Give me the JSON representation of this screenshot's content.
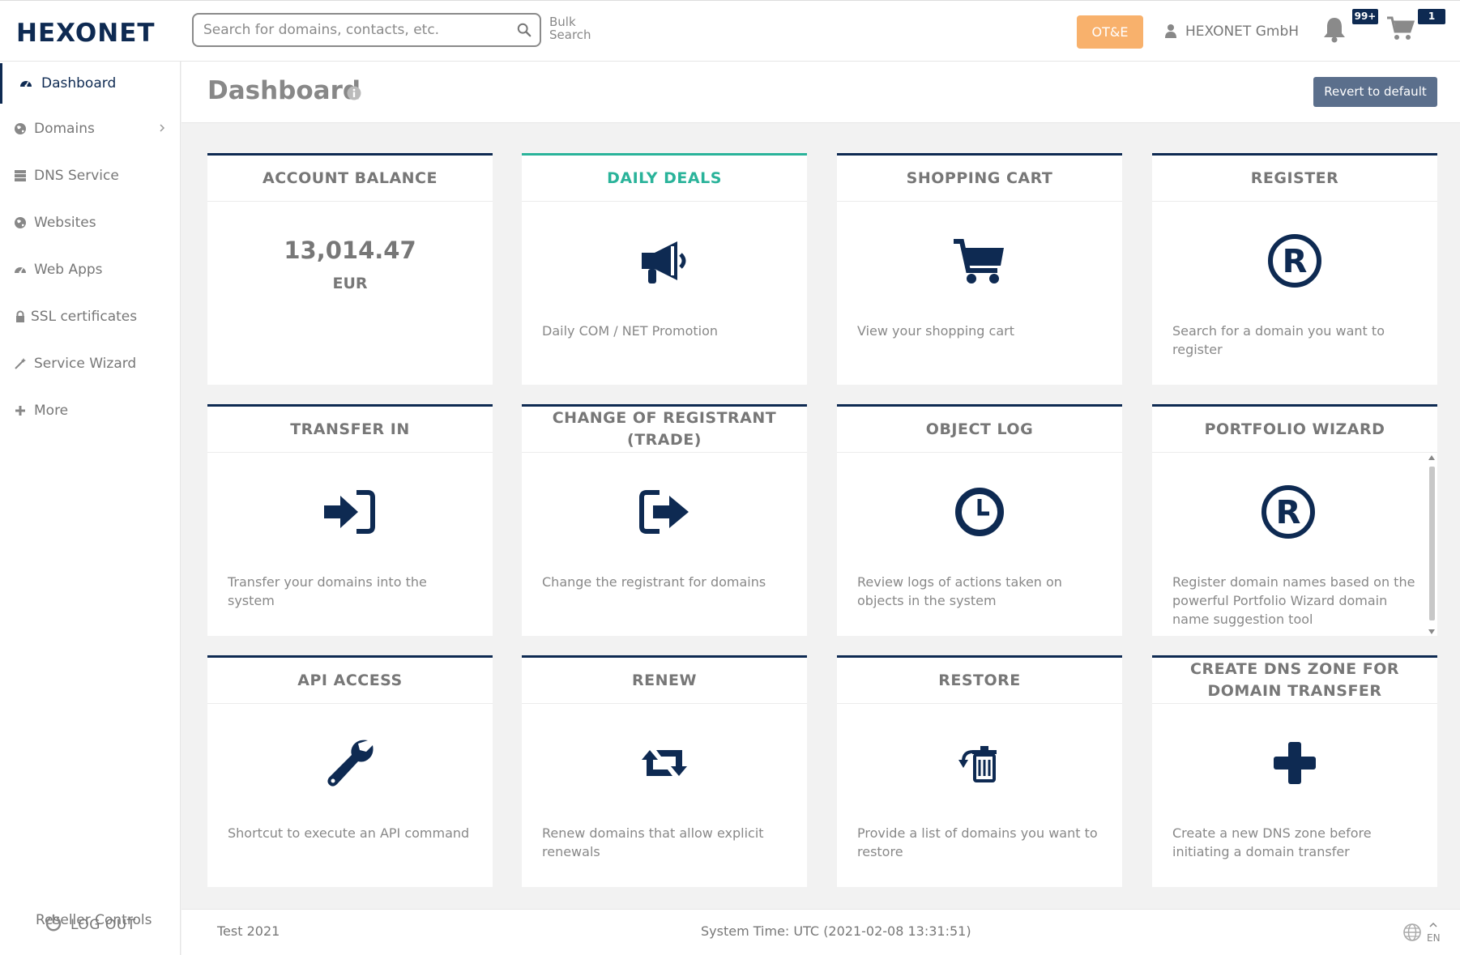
{
  "header": {
    "logo": "HEXONET",
    "search_placeholder": "Search for domains, contacts, etc.",
    "bulk_search_line1": "Bulk",
    "bulk_search_line2": "Search",
    "environment_button": "OT&E",
    "user_name": "HEXONET GmbH",
    "notifications_badge": "99+",
    "cart_badge": "1"
  },
  "sidebar": {
    "items": [
      {
        "label": "Dashboard",
        "icon": "dashboard-icon",
        "active": true
      },
      {
        "label": "Domains",
        "icon": "globe-icon",
        "has_submenu": true
      },
      {
        "label": "DNS Service",
        "icon": "server-icon"
      },
      {
        "label": "Websites",
        "icon": "globe-icon"
      },
      {
        "label": "Web Apps",
        "icon": "dashboard-icon"
      },
      {
        "label": "SSL certificates",
        "icon": "lock-icon"
      },
      {
        "label": "Service Wizard",
        "icon": "magic-wand-icon"
      },
      {
        "label": "More",
        "icon": "plus-icon"
      }
    ],
    "reseller_controls": "Reseller Controls",
    "logout": "LOG OUT"
  },
  "page": {
    "title": "Dashboard",
    "revert_button": "Revert to default"
  },
  "tiles": [
    {
      "title": "ACCOUNT BALANCE",
      "value": "13,014.47",
      "currency": "EUR"
    },
    {
      "title": "DAILY DEALS",
      "icon": "megaphone-icon",
      "description": "Daily COM / NET Promotion"
    },
    {
      "title": "SHOPPING CART",
      "icon": "cart-icon",
      "description": "View your shopping cart"
    },
    {
      "title": "REGISTER",
      "icon": "registered-icon",
      "description": "Search for a domain you want to register"
    },
    {
      "title": "TRANSFER IN",
      "icon": "sign-in-icon",
      "description": "Transfer your domains into the system"
    },
    {
      "title": "CHANGE OF REGISTRANT (TRADE)",
      "icon": "share-icon",
      "description": "Change the registrant for domains"
    },
    {
      "title": "OBJECT LOG",
      "icon": "clock-icon",
      "description": "Review logs of actions taken on objects in the system"
    },
    {
      "title": "PORTFOLIO WIZARD",
      "icon": "registered-icon",
      "description": "Register domain names based on the powerful Portfolio Wizard domain name suggestion tool"
    },
    {
      "title": "API ACCESS",
      "icon": "wrench-icon",
      "description": "Shortcut to execute an API command"
    },
    {
      "title": "RENEW",
      "icon": "retweet-icon",
      "description": "Renew domains that allow explicit renewals"
    },
    {
      "title": "RESTORE",
      "icon": "restore-trash-icon",
      "description": "Provide a list of domains you want to restore"
    },
    {
      "title": "CREATE DNS ZONE FOR DOMAIN TRANSFER",
      "icon": "plus-icon",
      "description": "Create a new DNS zone before initiating a domain transfer"
    }
  ],
  "footer": {
    "left": "Test 2021",
    "system_time": "System Time: UTC (2021-02-08 13:31:51)",
    "language": "EN"
  },
  "colors": {
    "brand_navy": "#0e2a52",
    "accent_teal": "#2ab39a",
    "ote_orange": "#f8b16c",
    "revert_button": "#5b6f8c"
  }
}
